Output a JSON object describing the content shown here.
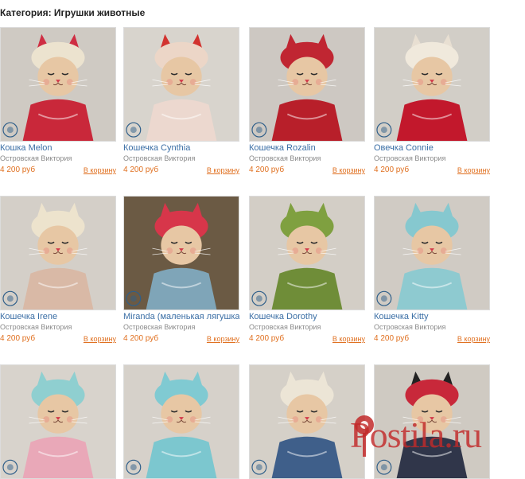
{
  "category": {
    "label": "Категория: Игрушки животные"
  },
  "products": [
    {
      "name": "Кошка Melon",
      "author": "Островская Виктория",
      "price": "4 200 руб",
      "cart": "В корзину",
      "bg": "#cfcac3",
      "body": "#c9283a",
      "hat": "#ece3cf",
      "ears": "#cf2e43"
    },
    {
      "name": "Кошечка Cynthia",
      "author": "Островская Виктория",
      "price": "4 200 руб",
      "cart": "В корзину",
      "bg": "#d8d4cd",
      "body": "#ecd8cf",
      "hat": "#ecd6c7",
      "ears": "#d2332f"
    },
    {
      "name": "Кошечка Rozalin",
      "author": "Островская Виктория",
      "price": "4 200 руб",
      "cart": "В корзину",
      "bg": "#cdc8c2",
      "body": "#b81f2a",
      "hat": "#c02632",
      "ears": "#c02632"
    },
    {
      "name": "Овечка Connie",
      "author": "Островская Виктория",
      "price": "4 200 руб",
      "cart": "В корзину",
      "bg": "#d2cec7",
      "body": "#c2182c",
      "hat": "#f0e9dc",
      "ears": "#e8dfd2"
    },
    {
      "name": "Кошечка Irene",
      "author": "Островская Виктория",
      "price": "4 200 руб",
      "cart": "В корзину",
      "bg": "#d4cfc8",
      "body": "#d9b9a6",
      "hat": "#ede3cd",
      "ears": "#ede3cd"
    },
    {
      "name": "Miranda (маленькая лягушка)",
      "author": "Островская Виктория",
      "price": "4 200 руб",
      "cart": "В корзину",
      "bg": "#6b5a44",
      "body": "#7fa5b8",
      "hat": "#d7364a",
      "ears": "#d7364a"
    },
    {
      "name": "Кошечка Dorothy",
      "author": "Островская Виктория",
      "price": "4 200 руб",
      "cart": "В корзину",
      "bg": "#d3cec6",
      "body": "#6f8d38",
      "hat": "#7fa040",
      "ears": "#7fa040"
    },
    {
      "name": "Кошечка Kitty",
      "author": "Островская Виктория",
      "price": "4 200 руб",
      "cart": "В корзину",
      "bg": "#d0cbc4",
      "body": "#8ecad0",
      "hat": "#86c8cf",
      "ears": "#86c8cf"
    },
    {
      "name": "",
      "author": "",
      "price": "",
      "cart": "",
      "bg": "#d8d3cc",
      "body": "#e9a8b8",
      "hat": "#8fcfd0",
      "ears": "#8fcfd0"
    },
    {
      "name": "",
      "author": "",
      "price": "",
      "cart": "",
      "bg": "#d6d1ca",
      "body": "#7cc7cf",
      "hat": "#80cad2",
      "ears": "#80cad2"
    },
    {
      "name": "",
      "author": "",
      "price": "",
      "cart": "",
      "bg": "#d5d0c8",
      "body": "#3f5f8a",
      "hat": "#ece5d6",
      "ears": "#ece5d6"
    },
    {
      "name": "",
      "author": "",
      "price": "",
      "cart": "",
      "bg": "#cfcac2",
      "body": "#30364a",
      "hat": "#c8283a",
      "ears": "#222"
    }
  ],
  "watermark": {
    "text": "Postila.ru"
  },
  "colors": {
    "link": "#3a6ea5",
    "price": "#e07020",
    "author": "#8a8a8a",
    "brand": "#c22a2a"
  }
}
